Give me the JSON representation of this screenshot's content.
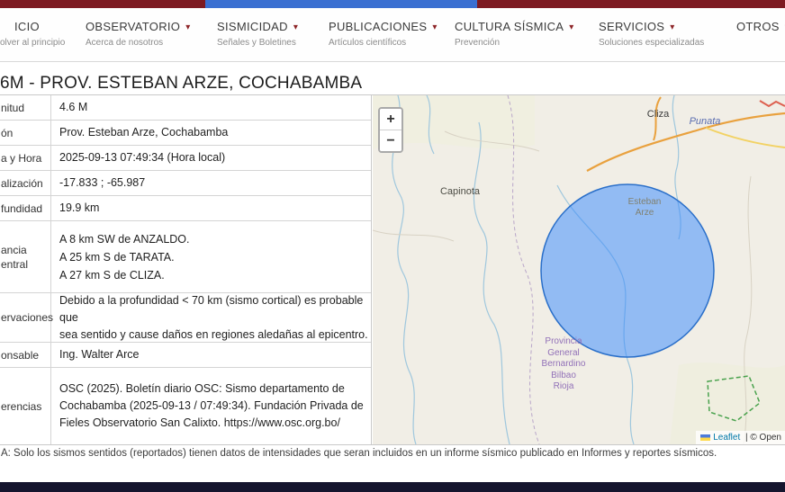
{
  "colors": {
    "topbar_red": "#7d1a21",
    "top_blue_bar": "#3a6fd1",
    "nav_caret_red": "#8d2427",
    "epicenter_circle": "#3388ff",
    "footer_dark": "#15152e"
  },
  "nav": {
    "items": [
      {
        "label": "ICIO",
        "caret": "",
        "sub": "olver al principio"
      },
      {
        "label": "OBSERVATORIO",
        "caret": "▾",
        "sub": "Acerca de nosotros"
      },
      {
        "label": "SISMICIDAD",
        "caret": "▾",
        "sub": "Señales y Boletines"
      },
      {
        "label": "PUBLICACIONES",
        "caret": "▾",
        "sub": "Artículos científicos"
      },
      {
        "label": "CULTURA SÍSMICA",
        "caret": "▾",
        "sub": "Prevención"
      },
      {
        "label": "SERVICIOS",
        "caret": "▾",
        "sub": "Soluciones especializadas"
      },
      {
        "label": "OTROS",
        "caret": "▾",
        "sub": ""
      }
    ]
  },
  "page": {
    "title": "6M - PROV. ESTEBAN ARZE, COCHABAMBA",
    "note": "A: Solo los sismos sentidos (reportados) tienen datos de intensidades que seran incluidos en un informe sísmico publicado en Informes y reportes sísmicos."
  },
  "table": {
    "rows": [
      {
        "label": "nitud",
        "value": "4.6 M"
      },
      {
        "label": "ón",
        "value": "Prov. Esteban Arze, Cochabamba"
      },
      {
        "label": "a y Hora",
        "value": "2025-09-13 07:49:34 (Hora local)"
      },
      {
        "label": "alización",
        "value": "-17.833 ; -65.987"
      },
      {
        "label": "fundidad",
        "value": "19.9 km"
      },
      {
        "label": "ancia\nentral",
        "value": "A 8 km SW de ANZALDO.\nA 25 km S de TARATA.\nA 27 km S de CLIZA."
      },
      {
        "label": "ervaciones",
        "value": "Debido a la profundidad < 70 km (sismo cortical) es probable que\nsea sentido y cause daños en regiones aledañas al epicentro."
      },
      {
        "label": "onsable",
        "value": "Ing. Walter Arce"
      },
      {
        "label": "erencias",
        "value": "OSC (2025). Boletín diario OSC: Sismo departamento de\nCochabamba (2025-09-13 / 07:49:34). Fundación Privada de\nFieles Observatorio San Calixto. https://www.osc.org.bo/"
      }
    ]
  },
  "map": {
    "zoom_in": "+",
    "zoom_out": "−",
    "labels": {
      "capinota": "Capinota",
      "esteban_arze": "Esteban\nArze",
      "cliza": "Cliza",
      "punata": "Punata",
      "provincia": "Provincia\nGeneral\nBernardino\nBilbao\nRioja"
    },
    "attribution": {
      "leaflet": "Leaflet",
      "rest": " | © Open"
    }
  }
}
